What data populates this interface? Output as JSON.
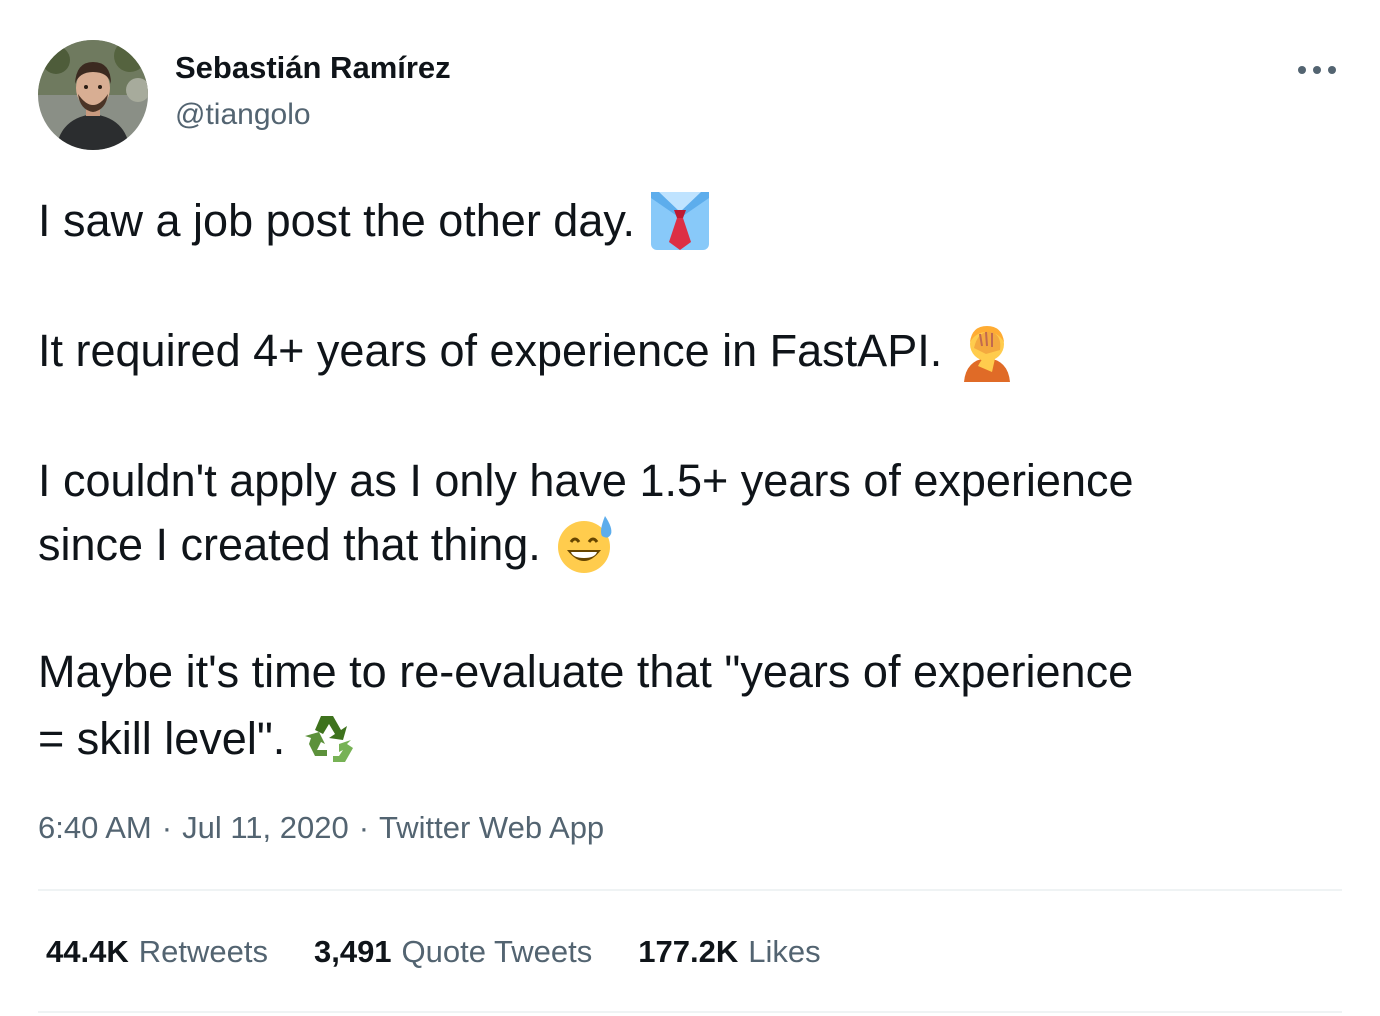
{
  "author": {
    "name": "Sebastián Ramírez",
    "handle": "@tiangolo"
  },
  "tweet": {
    "lines": [
      "I saw a job post the other day.",
      "It required 4+ years of experience in FastAPI.",
      "I couldn't apply as I only have 1.5+ years of experience",
      "since I created that thing.",
      "Maybe it's time to re-evaluate that \"years of experience",
      "= skill level\"."
    ],
    "emojis": [
      "necktie-emoji",
      "facepalm-emoji",
      "grinning-sweat-emoji",
      "recycling-emoji"
    ]
  },
  "meta": {
    "time": "6:40 AM",
    "separator": "·",
    "date": "Jul 11, 2020",
    "source": "Twitter Web App"
  },
  "stats": [
    {
      "value": "44.4K",
      "label": "Retweets"
    },
    {
      "value": "3,491",
      "label": "Quote Tweets"
    },
    {
      "value": "177.2K",
      "label": "Likes"
    }
  ],
  "colors": {
    "text": "#0f1419",
    "secondary": "#536471",
    "divider": "#eff3f4"
  },
  "icons": {
    "more": "more-horizontal-icon"
  }
}
